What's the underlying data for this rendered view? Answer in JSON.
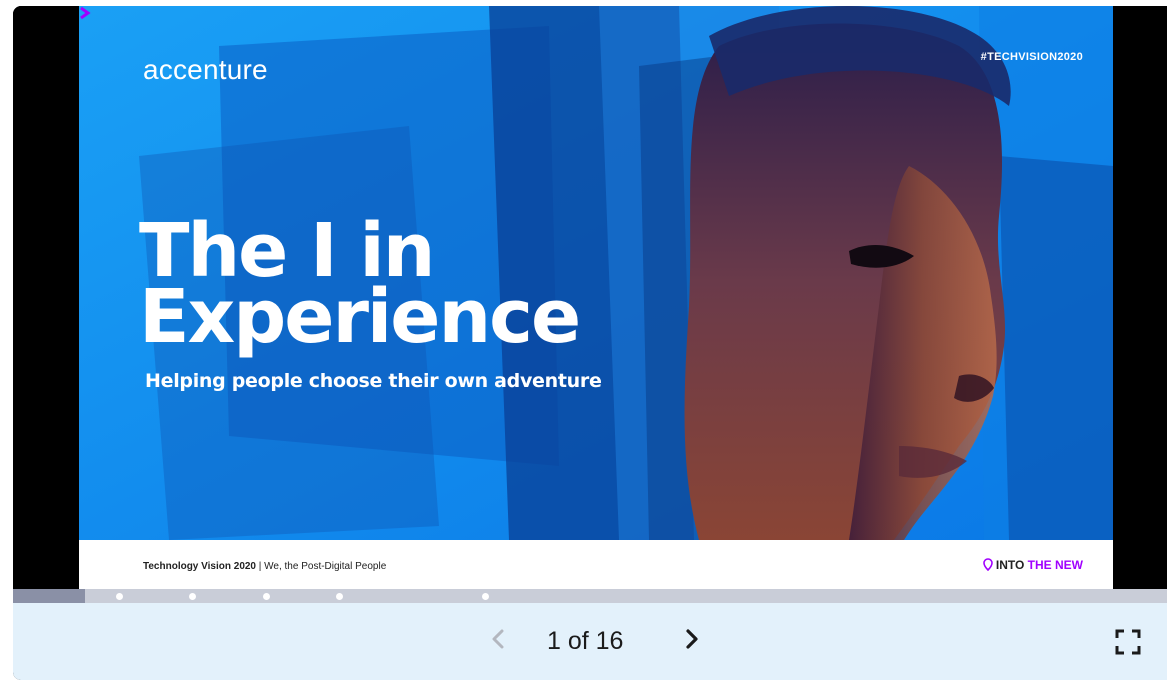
{
  "slide": {
    "logo_text": "accenture",
    "hashtag": "#TECHVISION2020",
    "headline_line1": "The I in",
    "headline_line2": "Experience",
    "subhead": "Helping people choose their own adventure",
    "footer_title": "Technology Vision 2020",
    "footer_separator": " | ",
    "footer_subtitle": "We, the Post-Digital People",
    "footer_tag_into": "INTO",
    "footer_tag_new": " THE NEW",
    "image_description": "portrait-face-blue-background"
  },
  "controls": {
    "prev_icon": "chevron-left-icon",
    "next_icon": "chevron-right-icon",
    "page_counter": "1 of 16",
    "fullscreen_icon": "fullscreen-icon"
  },
  "progress": {
    "fraction": 0.0625
  },
  "colors": {
    "slide_blue": "#1496f0",
    "brand_purple": "#a100ff",
    "control_bar": "#e3f1fb",
    "progress_track": "#c9cdd8"
  }
}
